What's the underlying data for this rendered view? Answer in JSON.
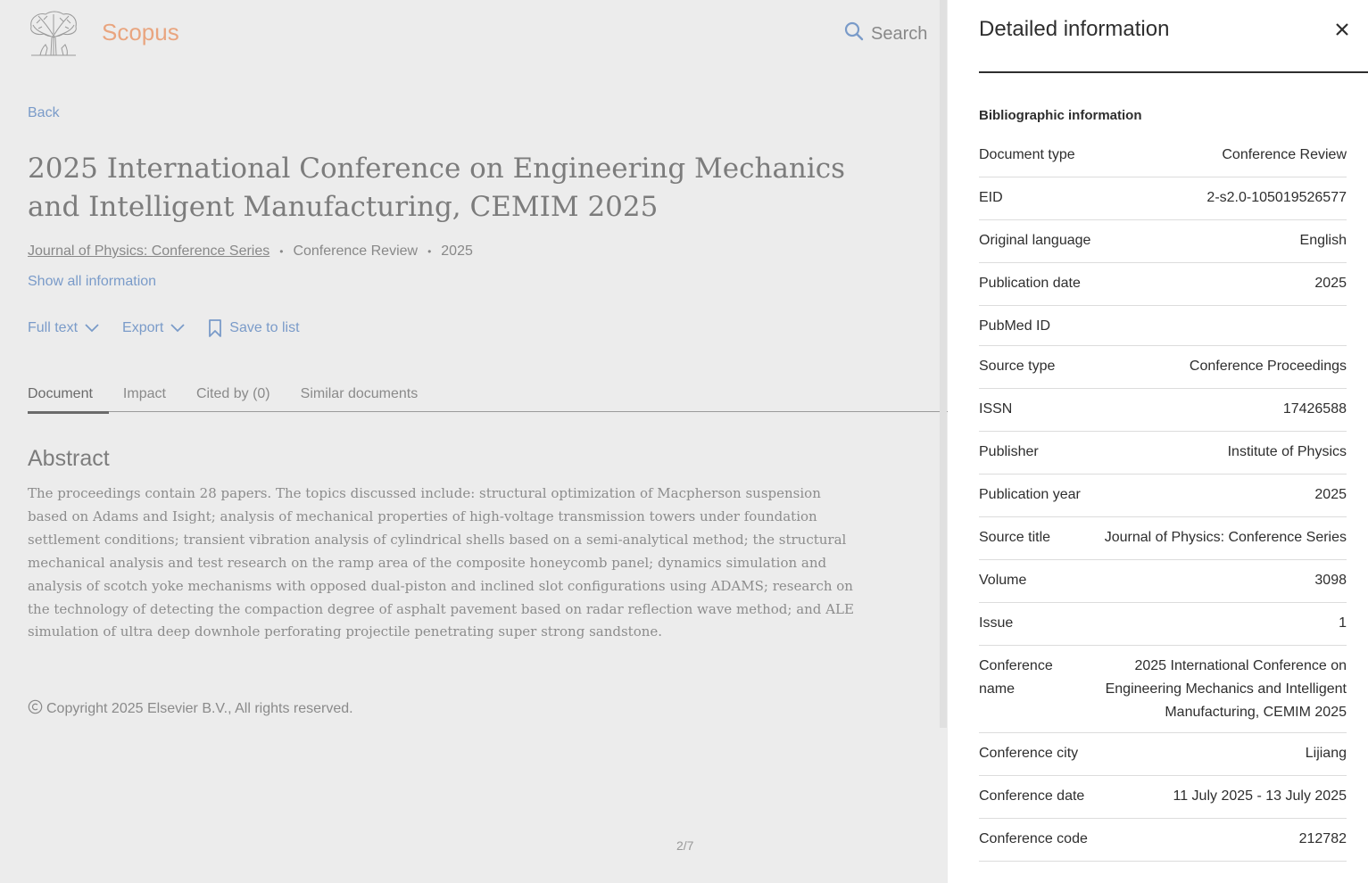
{
  "header": {
    "brand": "Scopus",
    "search_label": "Search"
  },
  "nav": {
    "back_label": "Back"
  },
  "document": {
    "title": "2025 International Conference on Engineering Mechanics and Intelligent Manufacturing, CEMIM 2025",
    "journal": "Journal of Physics: Conference Series",
    "doc_type": "Conference Review",
    "year": "2025",
    "show_all_label": "Show all information"
  },
  "actions": {
    "full_text": "Full text",
    "export": "Export",
    "save_to_list": "Save to list"
  },
  "tabs": [
    {
      "label": "Document",
      "active": true
    },
    {
      "label": "Impact",
      "active": false
    },
    {
      "label": "Cited by (0)",
      "active": false
    },
    {
      "label": "Similar documents",
      "active": false
    }
  ],
  "abstract": {
    "heading": "Abstract",
    "text": "The proceedings contain 28 papers. The topics discussed include: structural optimization of Macpherson suspension based on Adams and Isight; analysis of mechanical properties of high-voltage transmission towers under foundation settlement conditions; transient vibration analysis of cylindrical shells based on a semi-analytical method; the structural mechanical analysis and test research on the ramp area of the composite honeycomb panel; dynamics simulation and analysis of scotch yoke mechanisms with opposed dual-piston and inclined slot configurations using ADAMS; research on the technology of detecting the compaction degree of asphalt pavement based on radar reflection wave method; and ALE simulation of ultra deep downhole perforating projectile penetrating super strong sandstone.",
    "copyright": "Copyright 2025 Elsevier B.V., All rights reserved."
  },
  "pager": "2/7",
  "panel": {
    "title": "Detailed information",
    "section": "Bibliographic information",
    "rows": [
      {
        "key": "Document type",
        "value": "Conference Review"
      },
      {
        "key": "EID",
        "value": "2-s2.0-105019526577"
      },
      {
        "key": "Original language",
        "value": "English"
      },
      {
        "key": "Publication date",
        "value": "2025"
      },
      {
        "key": "PubMed ID",
        "value": ""
      },
      {
        "key": "Source type",
        "value": "Conference Proceedings"
      },
      {
        "key": "ISSN",
        "value": "17426588"
      },
      {
        "key": "Publisher",
        "value": "Institute of Physics"
      },
      {
        "key": "Publication year",
        "value": "2025"
      },
      {
        "key": "Source title",
        "value": "Journal of Physics: Conference Series"
      },
      {
        "key": "Volume",
        "value": "3098"
      },
      {
        "key": "Issue",
        "value": "1"
      },
      {
        "key": "Conference name",
        "value": "2025 International Conference on Engineering Mechanics and Intelligent Manufacturing, CEMIM 2025"
      },
      {
        "key": "Conference city",
        "value": "Lijiang"
      },
      {
        "key": "Conference date",
        "value": "11 July 2025 - 13 July 2025"
      },
      {
        "key": "Conference code",
        "value": "212782"
      }
    ]
  },
  "colors": {
    "brand": "#e9a57f",
    "link": "#7a9bc9",
    "overlay": "#ececec",
    "panel_text": "#2e2e2e"
  },
  "icons": [
    "elsevier-tree-logo-icon",
    "search-icon",
    "chevron-down-icon",
    "bookmark-icon",
    "copyright-icon",
    "close-icon"
  ]
}
